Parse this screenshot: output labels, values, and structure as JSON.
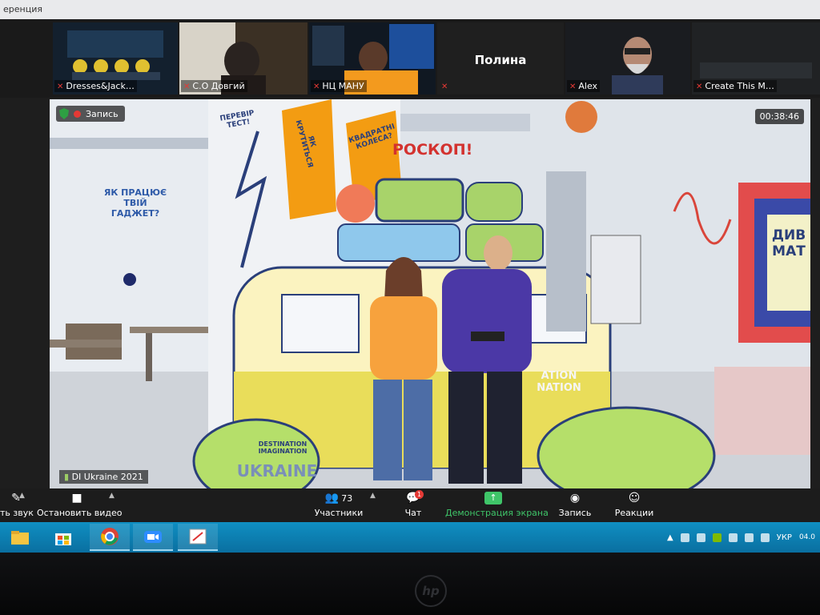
{
  "window": {
    "title": "еренция"
  },
  "gallery": {
    "tiles": [
      {
        "name": "Dresses&Jack…"
      },
      {
        "name": "С.О Довгий"
      },
      {
        "name": "НЦ МАНУ"
      },
      {
        "name": "Полина"
      },
      {
        "name": "Alex"
      },
      {
        "name": "Create This M…"
      }
    ]
  },
  "main_video": {
    "recording_label": "Запись",
    "timer": "00:38:46",
    "camera_name": "DI Ukraine 2021",
    "exhibit": {
      "question": "ЯК ПРАЦЮЄ ТВІЙ ГАДЖЕТ?",
      "kaleidoscope": "РОСКОП!",
      "test": "ПЕРЕВІР ТЕСТ!",
      "wheels": "КВАДРАТНІ КОЛЕСА?",
      "spin": "ЯК КРУТИТЬСЯ",
      "wonder": "ДИВ МАТ",
      "brand_small": "DESTINATION IMAGINATION",
      "brand_country": "UKRAINE",
      "van_text": "ATION NATION"
    }
  },
  "toolbar": {
    "sound_label": "ть звук",
    "video_label": "Остановить видео",
    "participants_label": "Участники",
    "participants_count": "73",
    "chat_label": "Чат",
    "chat_badge": "1",
    "share_label": "Демонстрация экрана",
    "record_label": "Запись",
    "reactions_label": "Реакции"
  },
  "taskbar": {
    "language": "УКР",
    "clock_partial": "04.0"
  },
  "colors": {
    "zoom_toolbar": "#1c1c1c",
    "share_green": "#3fc569",
    "taskbar_blue": "#0f8fc2",
    "mic_off_red": "#e53935"
  }
}
